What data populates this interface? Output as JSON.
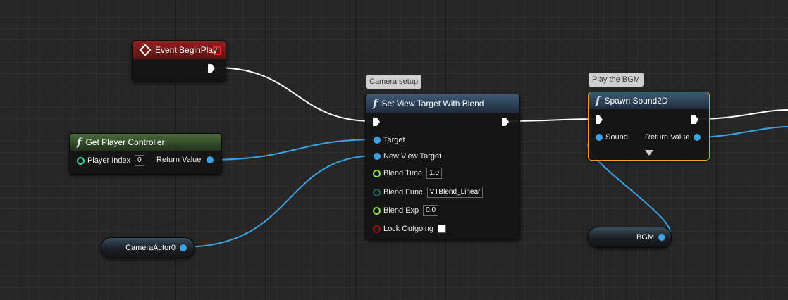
{
  "colors": {
    "exec": "#ffffff",
    "object_pin": "#3aa3e8",
    "int_pin": "#2fd3a0",
    "float_pin": "#8ee04e",
    "enum_pin": "#1d6a64",
    "bool_pin": "#a00f0f",
    "selected_border": "#e0a526"
  },
  "event_begin_play": {
    "title": "Event BeginPlay",
    "icon": "event-diamond-icon"
  },
  "get_player_controller": {
    "title": "Get Player Controller",
    "icon": "function-icon",
    "player_index_label": "Player Index",
    "player_index_value": "0",
    "return_label": "Return Value"
  },
  "set_view_target": {
    "comment": "Camera setup",
    "title": "Set View Target With Blend",
    "icon": "function-icon",
    "target_label": "Target",
    "new_view_target_label": "New View Target",
    "blend_time_label": "Blend Time",
    "blend_time_value": "1.0",
    "blend_func_label": "Blend Func",
    "blend_func_value": "VTBlend_Linear",
    "blend_exp_label": "Blend Exp",
    "blend_exp_value": "0.0",
    "lock_outgoing_label": "Lock Outgoing",
    "lock_outgoing_checked": false
  },
  "spawn_sound": {
    "comment": "Play the BGM",
    "title": "Spawn Sound2D",
    "icon": "function-icon",
    "sound_label": "Sound",
    "return_label": "Return Value",
    "expand_icon": "expand-arrow-icon"
  },
  "camera_actor": {
    "label": "CameraActor0"
  },
  "bgm_var": {
    "label": "BGM"
  }
}
